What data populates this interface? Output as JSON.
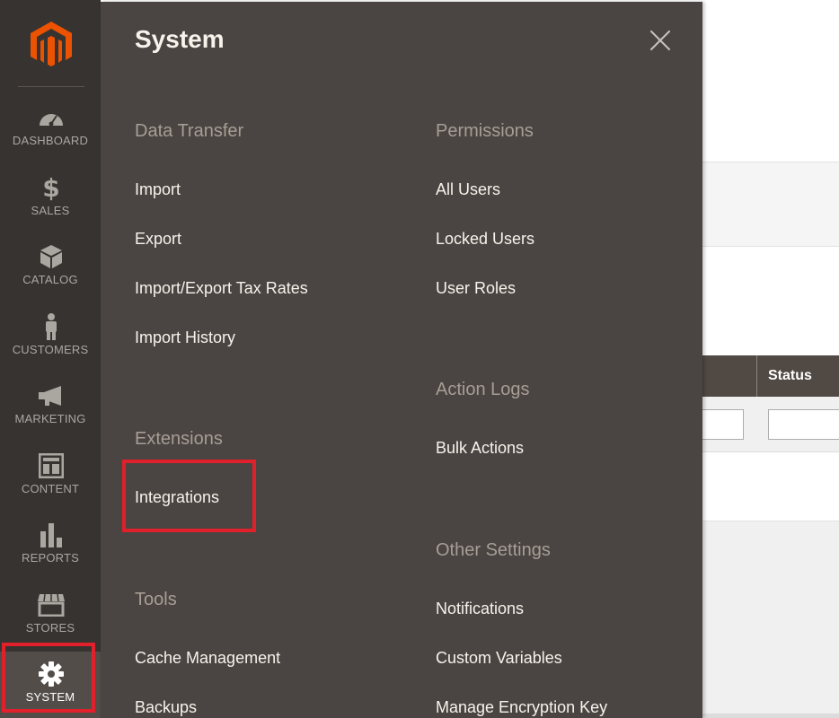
{
  "background": {
    "table_header_status": "Status"
  },
  "sidebar": {
    "logo": "magento-logo",
    "items": [
      {
        "label": "DASHBOARD",
        "icon": "dashboard-gauge-icon"
      },
      {
        "label": "SALES",
        "icon": "dollar-icon"
      },
      {
        "label": "CATALOG",
        "icon": "cube-icon"
      },
      {
        "label": "CUSTOMERS",
        "icon": "person-icon"
      },
      {
        "label": "MARKETING",
        "icon": "megaphone-icon"
      },
      {
        "label": "CONTENT",
        "icon": "layout-icon"
      },
      {
        "label": "REPORTS",
        "icon": "bar-chart-icon"
      },
      {
        "label": "STORES",
        "icon": "storefront-icon"
      },
      {
        "label": "SYSTEM",
        "icon": "gear-icon"
      }
    ],
    "active": "SYSTEM"
  },
  "flyout": {
    "title": "System",
    "close_icon": "close-icon",
    "groups": {
      "data_transfer": {
        "title": "Data Transfer",
        "links": [
          "Import",
          "Export",
          "Import/Export Tax Rates",
          "Import History"
        ]
      },
      "extensions": {
        "title": "Extensions",
        "links": [
          "Integrations"
        ]
      },
      "tools": {
        "title": "Tools",
        "links": [
          "Cache Management",
          "Backups"
        ]
      },
      "permissions": {
        "title": "Permissions",
        "links": [
          "All Users",
          "Locked Users",
          "User Roles"
        ]
      },
      "action_logs": {
        "title": "Action Logs",
        "links": [
          "Bulk Actions"
        ]
      },
      "other_settings": {
        "title": "Other Settings",
        "links": [
          "Notifications",
          "Custom Variables",
          "Manage Encryption Key"
        ]
      }
    }
  },
  "colors": {
    "sidebar_bg": "#373330",
    "flyout_bg": "#4a4542",
    "brand_orange": "#eb5202",
    "highlight_red": "#e0202a"
  }
}
